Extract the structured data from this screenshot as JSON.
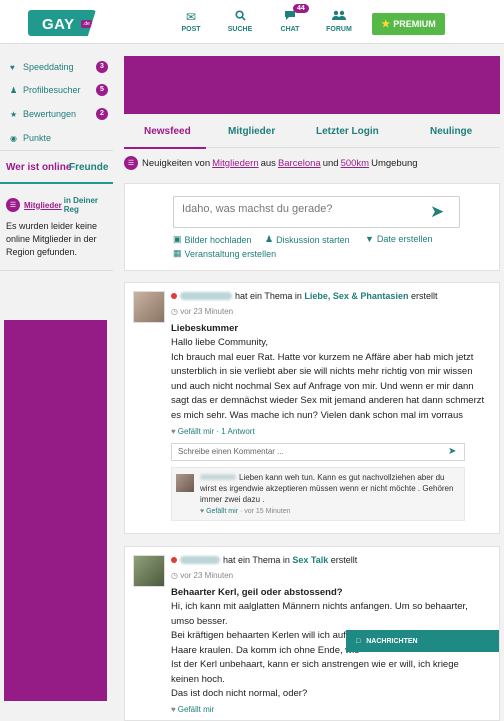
{
  "header": {
    "logo_text": "GAY",
    "logo_badge": ".de",
    "nav": [
      {
        "label": "POST",
        "icon": "envelope-icon"
      },
      {
        "label": "SUCHE",
        "icon": "search-icon"
      },
      {
        "label": "CHAT",
        "icon": "chat-icon",
        "badge": "44"
      },
      {
        "label": "FORUM",
        "icon": "users-icon"
      }
    ],
    "premium_label": "PREMIUM"
  },
  "sidebar": {
    "items": [
      {
        "label": "Speeddating",
        "icon": "heart-icon",
        "count": "3"
      },
      {
        "label": "Profilbesucher",
        "icon": "user-icon",
        "count": "5"
      },
      {
        "label": "Bewertungen",
        "icon": "star-icon",
        "count": "2"
      },
      {
        "label": "Punkte",
        "icon": "coins-icon"
      }
    ],
    "tabs": {
      "online": "Wer ist online",
      "friends": "Freunde"
    },
    "online_prefix": "Mitglieder",
    "online_suffix": "in Deiner Reg",
    "empty_message": "Es wurden leider keine online Mitglieder in der Region gefunden."
  },
  "main": {
    "tabs": [
      "Newsfeed",
      "Mitglieder",
      "Letzter Login",
      "Neulinge"
    ],
    "news_line": {
      "p1": "Neuigkeiten von",
      "members": "Mitgliedern",
      "p2": "aus",
      "city": "Barcelona",
      "p3": "und",
      "radius": "500km",
      "p4": "Umgebung"
    },
    "composer": {
      "placeholder": "Idaho, was machst du gerade?",
      "actions": [
        "Bilder hochladen",
        "Diskussion starten",
        "Date erstellen",
        "Veranstaltung erstellen"
      ]
    },
    "posts": [
      {
        "action": "hat ein Thema in",
        "category": "Liebe, Sex & Phantasien",
        "action2": "erstellt",
        "time": "vor 23 Minuten",
        "title": "Liebeskummer",
        "body": "Hallo liebe Community,\nIch brauch mal euer Rat. Hatte vor kurzem ne Affäre aber hab mich jetzt unsterblich in sie verliebt aber sie will nichts mehr richtig von mir wissen und auch nicht nochmal Sex auf Anfrage von mir. Und wenn er mir dann sagt das er demnächst wieder Sex mit jemand anderen hat dann schmerzt es mich sehr. Was mache ich nun? Vielen dank schon mal im vorraus",
        "likes": "Gefällt mir · 1 Antwort",
        "comment_placeholder": "Schreibe einen Kommentar ...",
        "reply_text": "Lieben kann weh tun. Kann es gut nachvollziehen aber du wirst es irgendwie akzeptieren müssen wenn er nicht möchte . Gehören immer zwei dazu .",
        "reply_like": "Gefällt mir",
        "reply_time": "· vor 15 Minuten"
      },
      {
        "action": "hat ein Thema in",
        "category": "Sex Talk",
        "action2": "erstellt",
        "time": "vor 23 Minuten",
        "title": "Behaarter Kerl, geil oder abstossend?",
        "body": "Hi, ich kann mit aalglatten Männern nichts anfangen. Um so behaarter, umso besser.\nBei kräftigen behaarten Kerlen will ich auf de\nHaare kraulen. Da komm ich ohne Ende, wie\nIst der Kerl unbehaart, kann er sich anstrengen wie er will, ich kriege keinen hoch.\nDas ist doch nicht normal, oder?",
        "likes": "Gefällt mir"
      }
    ]
  },
  "messages_bar": "NACHRICHTEN",
  "colors": {
    "accent": "#9b1c8a",
    "teal": "#1f7f7a",
    "premium": "#56b947"
  }
}
